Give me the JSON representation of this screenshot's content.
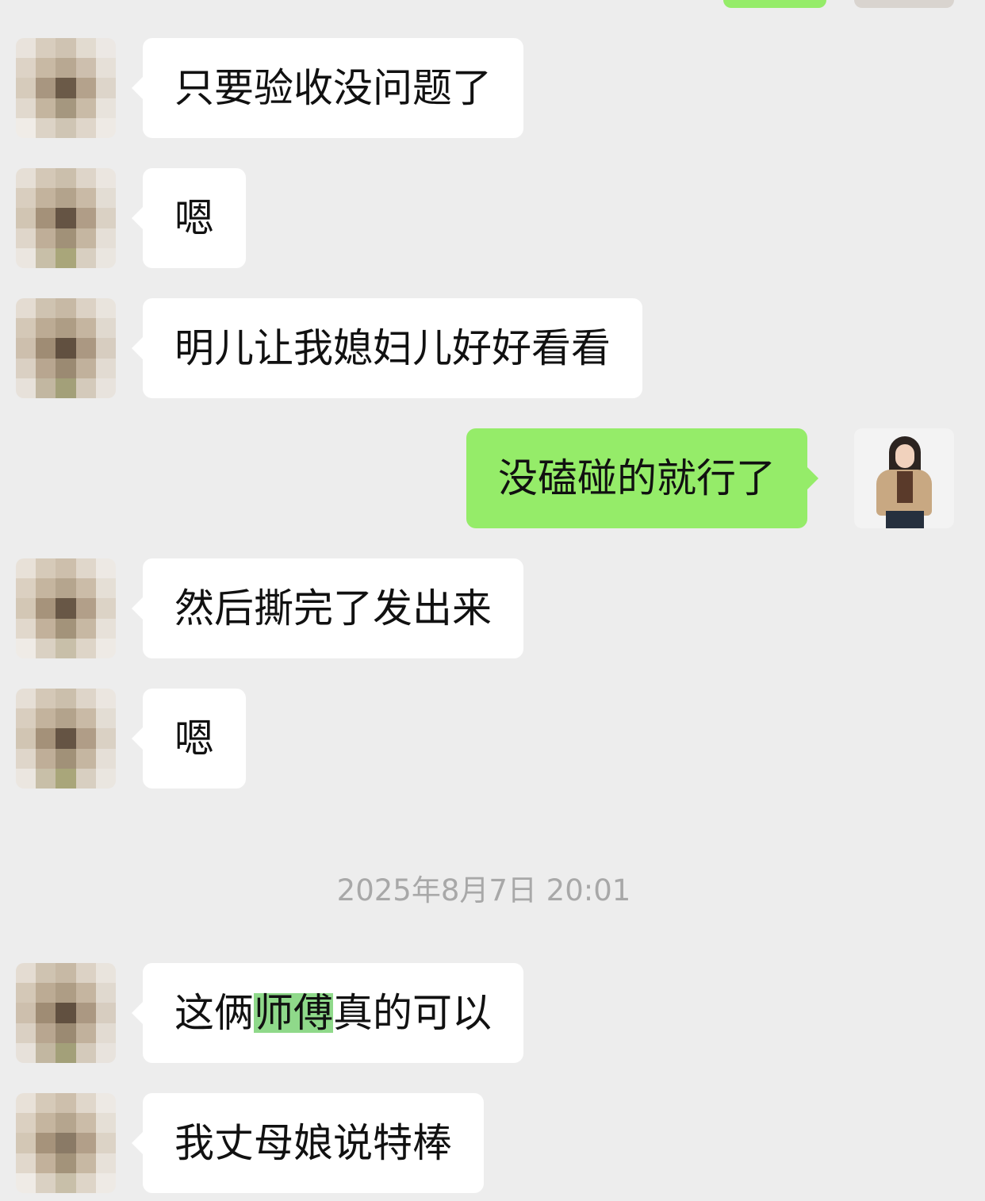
{
  "timestamp": "2025年8月7日 20:01",
  "colors": {
    "background": "#ededed",
    "incoming_bubble": "#ffffff",
    "outgoing_bubble": "#95ec69",
    "highlight": "#8fd98a"
  },
  "messages": [
    {
      "sender": "other",
      "text": "只要验收没问题了"
    },
    {
      "sender": "other",
      "text": "嗯"
    },
    {
      "sender": "other",
      "text": "明儿让我媳妇儿好好看看"
    },
    {
      "sender": "me",
      "text": "没磕碰的就行了"
    },
    {
      "sender": "other",
      "text": "然后撕完了发出来"
    },
    {
      "sender": "other",
      "text": "嗯"
    },
    {
      "sender": "other",
      "text_before": "这俩",
      "text_highlight": "师傅",
      "text_after": "真的可以"
    },
    {
      "sender": "other",
      "text": "我丈母娘说特棒"
    }
  ]
}
